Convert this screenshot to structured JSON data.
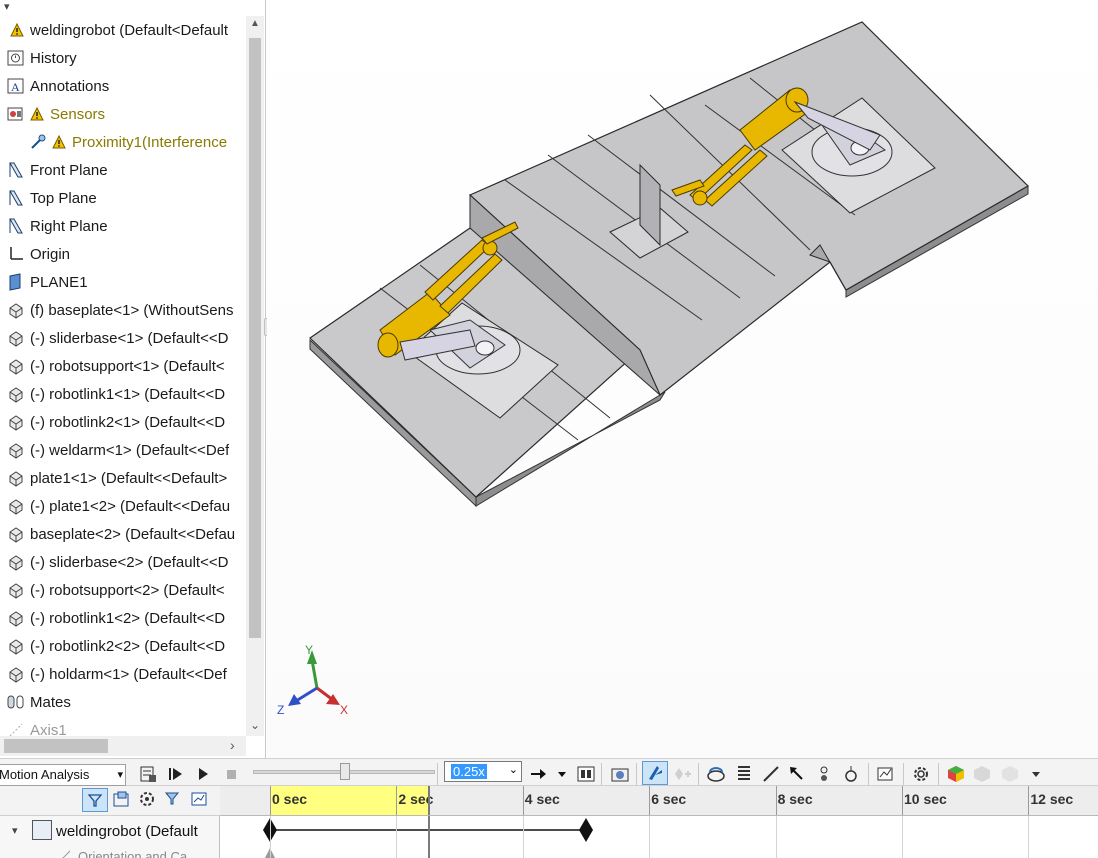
{
  "tree": {
    "top_partial": "",
    "items": [
      {
        "label": "weldingrobot  (Default<Default",
        "icon": "assembly-icon",
        "warning": true
      },
      {
        "label": "History",
        "icon": "history-icon"
      },
      {
        "label": "Annotations",
        "icon": "annotations-icon"
      },
      {
        "label": "Sensors",
        "icon": "sensors-icon",
        "warning": true,
        "olive": true
      },
      {
        "label": "Proximity1(Interference",
        "icon": "proximity-sensor-icon",
        "warning": true,
        "olive": true,
        "indent": true
      },
      {
        "label": "Front Plane",
        "icon": "plane-icon"
      },
      {
        "label": "Top Plane",
        "icon": "plane-icon"
      },
      {
        "label": "Right Plane",
        "icon": "plane-icon"
      },
      {
        "label": "Origin",
        "icon": "origin-icon"
      },
      {
        "label": "PLANE1",
        "icon": "plane1-icon"
      },
      {
        "label": "(f) baseplate<1> (WithoutSens",
        "icon": "part-icon"
      },
      {
        "label": "(-) sliderbase<1> (Default<<D",
        "icon": "part-icon"
      },
      {
        "label": "(-) robotsupport<1> (Default<",
        "icon": "part-icon"
      },
      {
        "label": "(-) robotlink1<1> (Default<<D",
        "icon": "part-icon"
      },
      {
        "label": "(-) robotlink2<1> (Default<<D",
        "icon": "part-icon"
      },
      {
        "label": "(-) weldarm<1> (Default<<Def",
        "icon": "part-icon"
      },
      {
        "label": "plate1<1> (Default<<Default>",
        "icon": "part-icon"
      },
      {
        "label": "(-) plate1<2> (Default<<Defau",
        "icon": "part-icon"
      },
      {
        "label": "baseplate<2> (Default<<Defau",
        "icon": "part-icon"
      },
      {
        "label": "(-) sliderbase<2> (Default<<D",
        "icon": "part-icon"
      },
      {
        "label": "(-) robotsupport<2> (Default<",
        "icon": "part-icon"
      },
      {
        "label": "(-) robotlink1<2> (Default<<D",
        "icon": "part-icon"
      },
      {
        "label": "(-) robotlink2<2> (Default<<D",
        "icon": "part-icon"
      },
      {
        "label": "(-) holdarm<1> (Default<<Def",
        "icon": "part-icon"
      },
      {
        "label": "Mates",
        "icon": "mates-icon"
      },
      {
        "label": "Axis1",
        "icon": "axis-icon",
        "faded": true
      }
    ]
  },
  "triad": {
    "x": "X",
    "y": "Y",
    "z": "Z"
  },
  "motion": {
    "study_type": "Motion Analysis",
    "playback_speed": "0.25x",
    "slider_fraction": 0.48
  },
  "timeline": {
    "ticks": [
      "0 sec",
      "2 sec",
      "4 sec",
      "6 sec",
      "8 sec",
      "10 sec",
      "12 sec"
    ],
    "root_label": "weldingrobot  (Default",
    "child_label": "Orientation and Ca",
    "highlight_end_sec": 2.5,
    "key_start_sec": 0,
    "key_end_sec": 5,
    "playhead_sec": 2.5
  },
  "colors": {
    "warning": "#f2c200",
    "sensor_text": "#8a7a00",
    "selected_range": "#ffff80",
    "robot_yellow": "#e8b800"
  }
}
